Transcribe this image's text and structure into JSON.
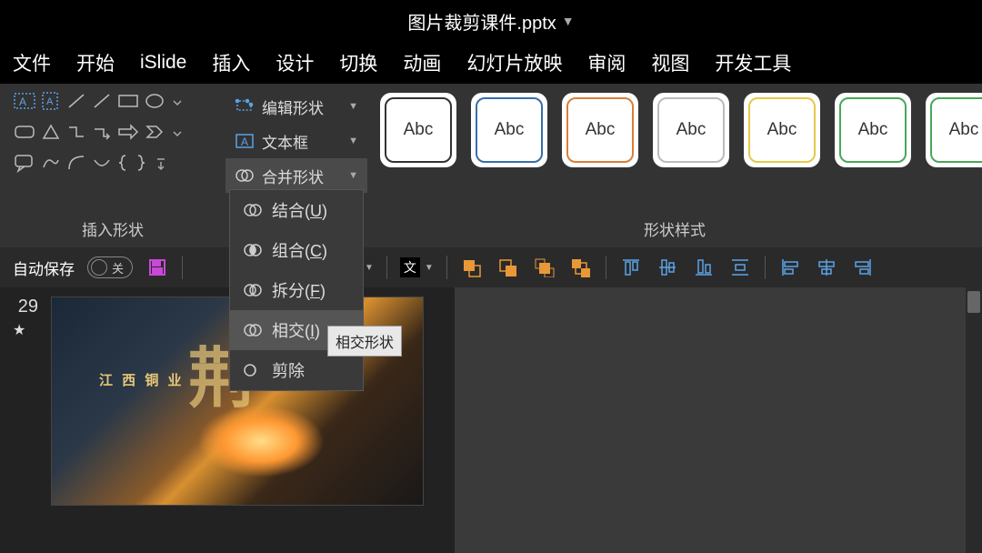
{
  "titlebar": {
    "filename": "图片裁剪课件.pptx"
  },
  "tabs": [
    "文件",
    "开始",
    "iSlide",
    "插入",
    "设计",
    "切换",
    "动画",
    "幻灯片放映",
    "审阅",
    "视图",
    "开发工具"
  ],
  "ribbon": {
    "insert_shapes_label": "插入形状",
    "edit_shape": "编辑形状",
    "text_box": "文本框",
    "merge_shapes": "合并形状",
    "styles_label": "形状样式",
    "style_text": "Abc",
    "style_borders": [
      "#333333",
      "#3a6ea8",
      "#d8803a",
      "#bbbbbb",
      "#e8c848",
      "#48a858",
      "#48a858"
    ]
  },
  "dropdown": {
    "items": [
      {
        "label": "结合",
        "key": "U"
      },
      {
        "label": "组合",
        "key": "C"
      },
      {
        "label": "拆分",
        "key": "F"
      },
      {
        "label": "相交",
        "key": "I"
      },
      {
        "label": "剪除",
        "key": ""
      }
    ],
    "hover_index": 3,
    "tooltip": "相交形状"
  },
  "qat": {
    "autosave": "自动保存",
    "toggle_off": "关"
  },
  "slide": {
    "number": "29",
    "thumb_small_text": "江 西 铜 业",
    "thumb_big_text": "荆"
  }
}
